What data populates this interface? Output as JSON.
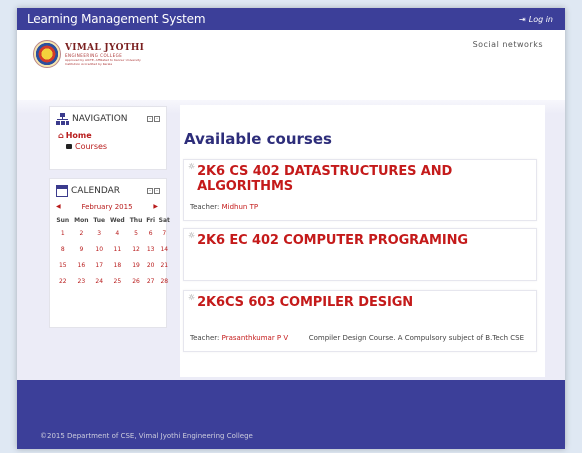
{
  "topbar": {
    "title": "Learning Management System",
    "login_label": "Log in"
  },
  "header": {
    "logo_line1": "VIMAL JYOTHI",
    "logo_line2": "ENGINEERING COLLEGE",
    "logo_line3": "Approved by AICTE, Affiliated to Kannur University",
    "logo_line4": "Institution Accredited by Kerala",
    "social": "Social networks"
  },
  "navigation": {
    "title": "NAVIGATION",
    "home": "Home",
    "courses": "Courses"
  },
  "calendar": {
    "title": "CALENDAR",
    "month": "February 2015",
    "days": [
      "Sun",
      "Mon",
      "Tue",
      "Wed",
      "Thu",
      "Fri",
      "Sat"
    ],
    "weeks": [
      [
        "1",
        "2",
        "3",
        "4",
        "5",
        "6",
        "7"
      ],
      [
        "8",
        "9",
        "10",
        "11",
        "12",
        "13",
        "14"
      ],
      [
        "15",
        "16",
        "17",
        "18",
        "19",
        "20",
        "21"
      ],
      [
        "22",
        "23",
        "24",
        "25",
        "26",
        "27",
        "28"
      ]
    ]
  },
  "main": {
    "title": "Available courses",
    "courses": [
      {
        "name": "2K6 CS 402 DATASTRUCTURES AND ALGORITHMS",
        "teacher_label": "Teacher:",
        "teacher": "Midhun TP",
        "summary": ""
      },
      {
        "name": "2K6 EC 402 COMPUTER PROGRAMING",
        "teacher_label": "",
        "teacher": "",
        "summary": ""
      },
      {
        "name": "2K6CS 603 COMPILER DESIGN",
        "teacher_label": "Teacher:",
        "teacher": "Prasanthkumar P V",
        "summary": "Compiler Design Course. A Compulsory subject of B.Tech CSE"
      }
    ]
  },
  "footer": {
    "text": "©2015 Department of CSE, Vimal Jyothi Engineering College"
  },
  "colors": {
    "accent": "#3c3f99",
    "link": "#c41a1a",
    "title": "#2d2d7a"
  }
}
